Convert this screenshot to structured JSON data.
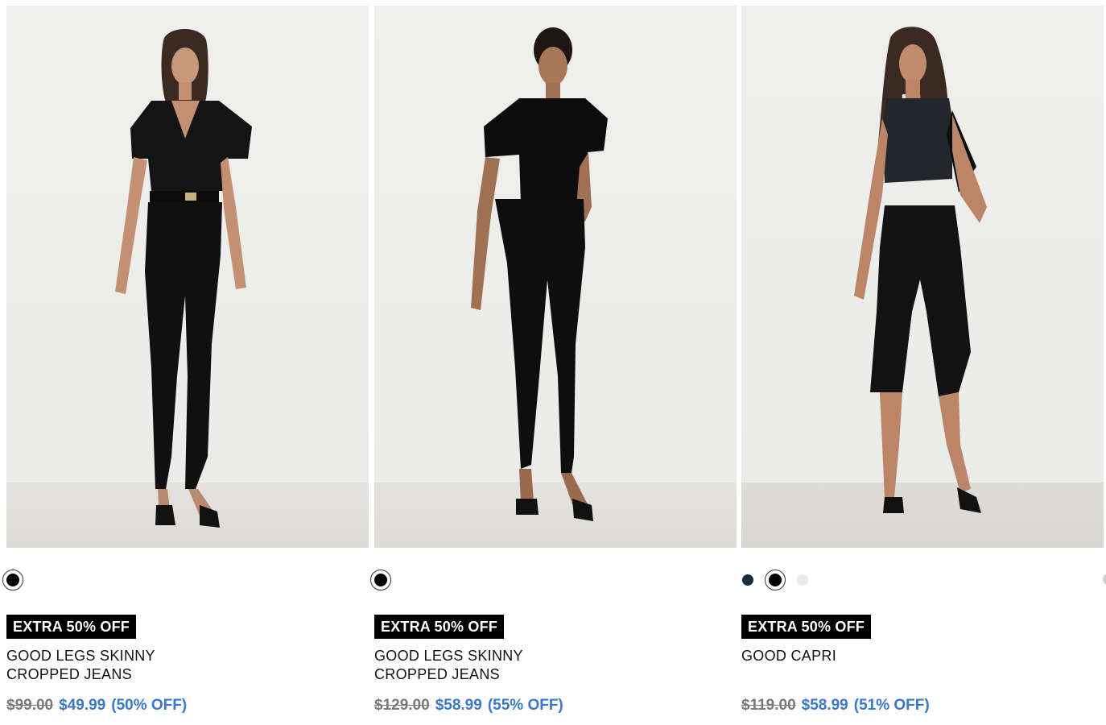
{
  "products": [
    {
      "badge": "EXTRA 50% OFF",
      "title_line1": "GOOD LEGS SKINNY",
      "title_line2": "CROPPED JEANS",
      "price_original": "$99.00",
      "price_sale": "$49.99",
      "discount": "(50% OFF)",
      "swatches": [
        {
          "color": "#000000",
          "selected": true
        }
      ]
    },
    {
      "badge": "EXTRA 50% OFF",
      "title_line1": "GOOD LEGS SKINNY",
      "title_line2": "CROPPED JEANS",
      "price_original": "$129.00",
      "price_sale": "$58.99",
      "discount": "(55% OFF)",
      "swatches": [
        {
          "color": "#000000",
          "selected": true
        }
      ]
    },
    {
      "badge": "EXTRA 50% OFF",
      "title_line1": "GOOD CAPRI",
      "title_line2": "",
      "price_original": "$119.00",
      "price_sale": "$58.99",
      "discount": "(51% OFF)",
      "swatches": [
        {
          "color": "#1c2a45",
          "selected": false
        },
        {
          "color": "#000000",
          "selected": true
        },
        {
          "color": "#e8e8e8",
          "selected": false
        }
      ]
    }
  ],
  "colors": {
    "sale_blue": "#3a78c9",
    "original_gray": "#7a7a7a",
    "badge_bg": "#000000",
    "badge_text": "#ffffff"
  }
}
